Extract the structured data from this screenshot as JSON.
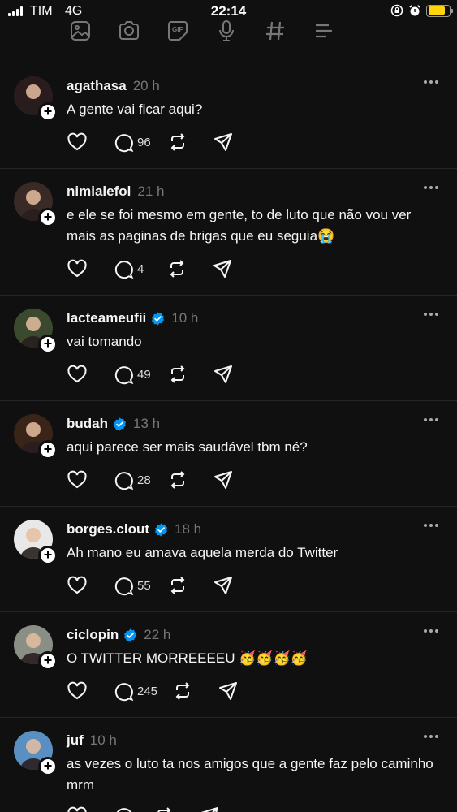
{
  "status": {
    "carrier": "TIM",
    "network": "4G",
    "time": "22:14",
    "battery_level": 0.8,
    "battery_color": "#ffd60a"
  },
  "composer_icons": [
    "image-icon",
    "camera-icon",
    "gif-icon",
    "microphone-icon",
    "hashtag-icon",
    "list-icon"
  ],
  "posts": [
    {
      "username": "agathasa",
      "verified": false,
      "time": "20 h",
      "text": "A gente vai ficar aqui?",
      "replies": "96",
      "avatar_color": "#2a1c1c"
    },
    {
      "username": "nimialefol",
      "verified": false,
      "time": "21 h",
      "text": "e ele se foi mesmo em gente, to de luto que não vou ver mais as paginas de brigas que eu seguia😭",
      "replies": "4",
      "avatar_color": "#3a2a26"
    },
    {
      "username": "lacteameufii",
      "verified": true,
      "time": "10 h",
      "text": "vai tomando",
      "replies": "49",
      "avatar_color": "#3b4a2e"
    },
    {
      "username": "budah",
      "verified": true,
      "time": "13 h",
      "text": "aqui parece ser mais saudável tbm né?",
      "replies": "28",
      "avatar_color": "#3a2418"
    },
    {
      "username": "borges.clout",
      "verified": true,
      "time": "18 h",
      "text": "Ah mano eu amava aquela merda do Twitter",
      "replies": "55",
      "avatar_color": "#e8e8e8"
    },
    {
      "username": "ciclopin",
      "verified": true,
      "time": "22 h",
      "text": "O TWITTER MORREEEEU 🥳🥳🥳🥳",
      "replies": "245",
      "avatar_color": "#8a8f86"
    },
    {
      "username": "juf",
      "verified": false,
      "time": "10 h",
      "text": "as vezes o luto ta nos amigos que a gente faz pelo caminho mrm",
      "replies": "",
      "avatar_color": "#5a8fc2"
    }
  ],
  "colors": {
    "background": "#101010",
    "verified": "#0095f6",
    "muted": "#777777"
  }
}
